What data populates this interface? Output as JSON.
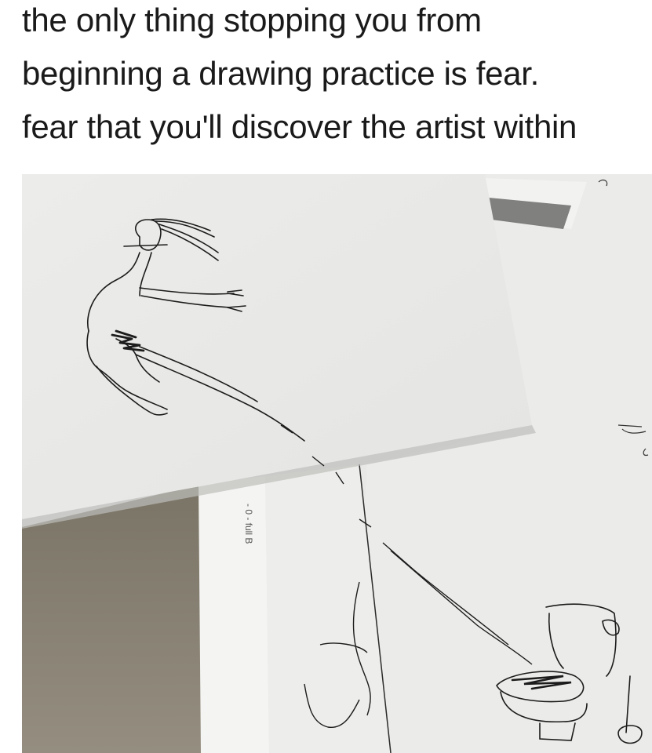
{
  "caption": {
    "line1": "the only thing stopping you from",
    "line2": "beginning a drawing practice is fear.",
    "line3": "fear that you'll discover the artist within"
  },
  "photo": {
    "subject": "pen-drawing-on-paper-sheets",
    "ruler_text": "- 0 - full B"
  },
  "colors": {
    "background": "#ffffff",
    "text": "#1a1a1a",
    "paper": "#eeeeec",
    "table": "#8c8577",
    "ink": "#1c1c1c"
  }
}
